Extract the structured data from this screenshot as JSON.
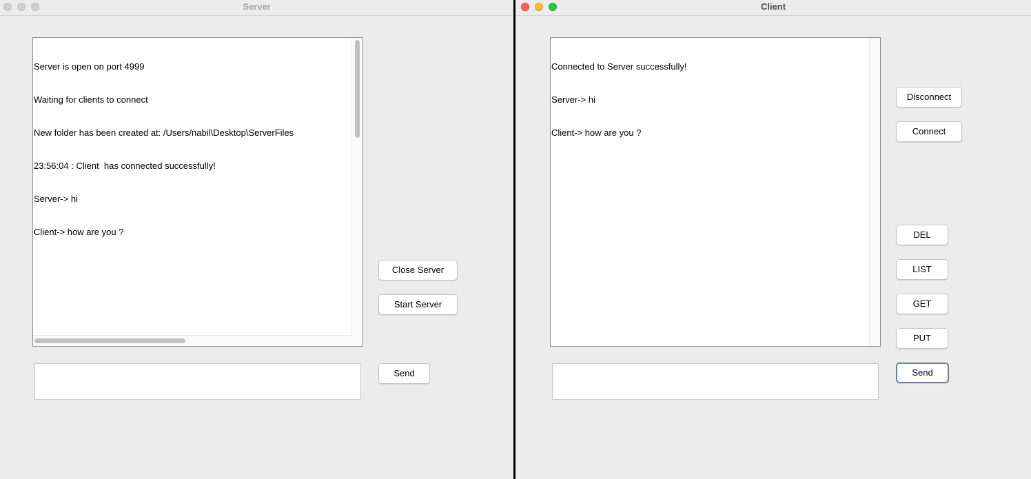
{
  "server": {
    "title": "Server",
    "log_lines": [
      "Server is open on port 4999",
      "Waiting for clients to connect",
      "New folder has been created at: /Users/nabil\\Desktop\\ServerFiles",
      "23:56:04 : Client  has connected successfully!",
      "Server-> hi",
      "Client-> how are you ?"
    ],
    "message_input": {
      "value": "",
      "placeholder": ""
    },
    "buttons": {
      "close_server": "Close Server",
      "start_server": "Start Server",
      "send": "Send"
    }
  },
  "client": {
    "title": "Client",
    "log_lines": [
      "Connected to Server successfully!",
      "Server-> hi",
      "Client-> how are you ?"
    ],
    "message_input": {
      "value": "",
      "placeholder": ""
    },
    "buttons": {
      "disconnect": "Disconnect",
      "connect": "Connect",
      "del": "DEL",
      "list": "LIST",
      "get": "GET",
      "put": "PUT",
      "send": "Send"
    }
  },
  "colors": {
    "window_bg": "#ececec",
    "close": "#fe5f57",
    "minimize": "#febc2e",
    "zoom": "#28c840",
    "inactive_control": "#d0d0d0",
    "focus_ring": "#6e7f99"
  },
  "icons": {
    "close": "close-icon",
    "minimize": "minimize-icon",
    "zoom": "zoom-icon"
  }
}
